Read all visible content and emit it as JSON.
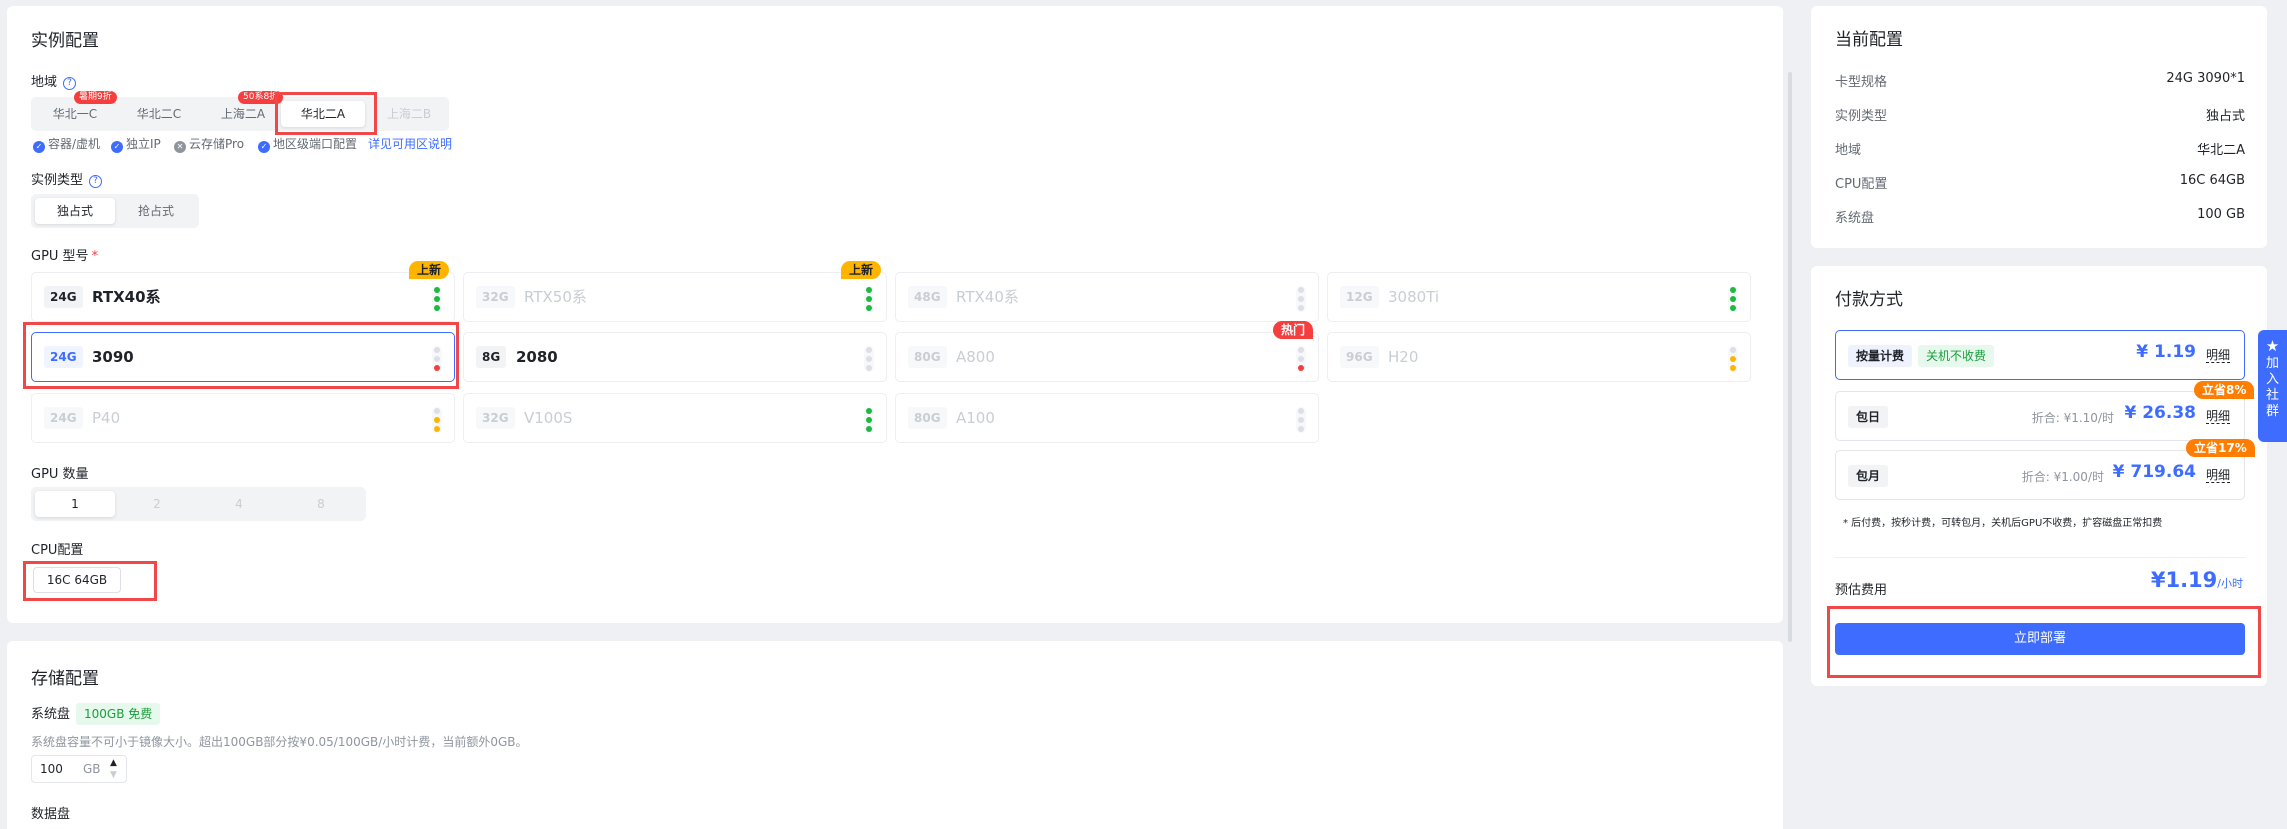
{
  "instance": {
    "title": "实例配置",
    "region_label": "地域",
    "regions": [
      {
        "label": "华北一C",
        "badge": "暑期9折",
        "state": "normal"
      },
      {
        "label": "华北二C",
        "badge": "",
        "state": "normal"
      },
      {
        "label": "上海二A",
        "badge": "50系8折",
        "state": "normal"
      },
      {
        "label": "华北二A",
        "badge": "",
        "state": "active"
      },
      {
        "label": "上海二B",
        "badge": "",
        "state": "disabled"
      }
    ],
    "features": [
      {
        "label": "容器/虚机",
        "checked": true
      },
      {
        "label": "独立IP",
        "checked": true
      },
      {
        "label": "云存储Pro",
        "checked": false
      },
      {
        "label": "地区级端口配置",
        "checked": true
      }
    ],
    "region_link": "详见可用区说明",
    "type_label": "实例类型",
    "types": [
      "独占式",
      "抢占式"
    ],
    "gpu_label": "GPU 型号",
    "required_mark": "*",
    "gpus": [
      {
        "mem": "24G",
        "name": "RTX40系",
        "state": "normal",
        "tag": "上新",
        "dots": [
          "g",
          "g",
          "g"
        ]
      },
      {
        "mem": "32G",
        "name": "RTX50系",
        "state": "dim",
        "tag": "上新",
        "dots": [
          "g",
          "g",
          "g"
        ]
      },
      {
        "mem": "48G",
        "name": "RTX40系",
        "state": "dim",
        "tag": "",
        "dots": [
          "e",
          "e",
          "e"
        ]
      },
      {
        "mem": "12G",
        "name": "3080Ti",
        "state": "dim",
        "tag": "",
        "dots": [
          "g",
          "g",
          "g"
        ]
      },
      {
        "mem": "24G",
        "name": "3090",
        "state": "selected",
        "tag": "",
        "dots": [
          "e",
          "e",
          "r"
        ]
      },
      {
        "mem": "8G",
        "name": "2080",
        "state": "normal",
        "tag": "",
        "dots": [
          "e",
          "e",
          "e"
        ]
      },
      {
        "mem": "80G",
        "name": "A800",
        "state": "dim",
        "tag": "热门",
        "dots": [
          "e",
          "e",
          "r"
        ]
      },
      {
        "mem": "96G",
        "name": "H20",
        "state": "dim",
        "tag": "",
        "dots": [
          "e",
          "y",
          "y"
        ]
      },
      {
        "mem": "24G",
        "name": "P40",
        "state": "dim",
        "tag": "",
        "dots": [
          "e",
          "y",
          "y"
        ]
      },
      {
        "mem": "32G",
        "name": "V100S",
        "state": "dim",
        "tag": "",
        "dots": [
          "g",
          "g",
          "g"
        ]
      },
      {
        "mem": "80G",
        "name": "A100",
        "state": "dim",
        "tag": "",
        "dots": [
          "e",
          "e",
          "e"
        ]
      }
    ],
    "gpu_count_label": "GPU 数量",
    "gpu_counts": [
      "1",
      "2",
      "4",
      "8"
    ],
    "cpu_label": "CPU配置",
    "cpu_option": "16C 64GB"
  },
  "storage": {
    "title": "存储配置",
    "system_disk_label": "系统盘",
    "free_tag": "100GB 免费",
    "note": "系统盘容量不可小于镜像大小。超出100GB部分按¥0.05/100GB/小时计费，当前额外0GB。",
    "disk_value": "100",
    "disk_unit": "GB",
    "data_disk_label": "数据盘"
  },
  "current": {
    "title": "当前配置",
    "rows": [
      {
        "k": "卡型规格",
        "v": "24G 3090*1"
      },
      {
        "k": "实例类型",
        "v": "独占式"
      },
      {
        "k": "地域",
        "v": "华北二A"
      },
      {
        "k": "CPU配置",
        "v": "16C 64GB"
      },
      {
        "k": "系统盘",
        "v": "100 GB"
      }
    ]
  },
  "payment": {
    "title": "付款方式",
    "options": [
      {
        "label": "按量计费",
        "free": "关机不收费",
        "fold": "",
        "price": "¥ 1.19",
        "detail": "明细",
        "save": ""
      },
      {
        "label": "包日",
        "free": "",
        "fold": "折合: ¥1.10/时",
        "price": "¥ 26.38",
        "detail": "明细",
        "save": "立省8%"
      },
      {
        "label": "包月",
        "free": "",
        "fold": "折合: ¥1.00/时",
        "price": "¥ 719.64",
        "detail": "明细",
        "save": "立省17%"
      }
    ],
    "note": "* 后付费，按秒计费，可转包月，关机后GPU不收费，扩容磁盘正常扣费",
    "estimate_label": "预估费用",
    "estimate_value": "¥1.19",
    "estimate_unit": "/小时",
    "deploy": "立即部署"
  },
  "community": "加入社群",
  "colors": {
    "accent": "#3d6cff",
    "danger": "#f53f3f",
    "success": "#1db941",
    "warning": "#ffb400",
    "orange": "#ff7d00"
  }
}
